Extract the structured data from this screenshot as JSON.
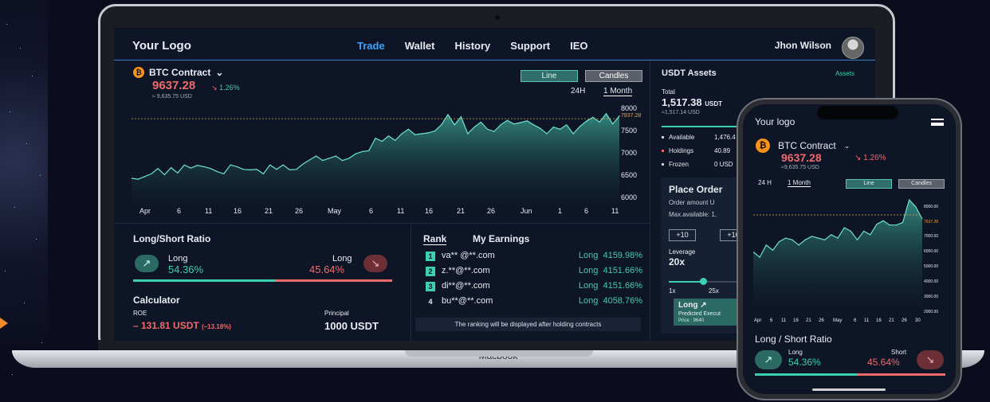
{
  "laptop_brand": "Macbook",
  "desktop": {
    "logo": "Your Logo",
    "nav": [
      "Trade",
      "Wallet",
      "History",
      "Support",
      "IEO"
    ],
    "user": "Jhon Wilson",
    "contract": "BTC Contract",
    "contract_icon": "bitcoin-icon",
    "price": "9637.28",
    "change": "1.26%",
    "subprice": "≈ 9,635.75 USD",
    "chart_mode_buttons": [
      "Line",
      "Candles"
    ],
    "ranges": [
      "24H",
      "1 Month"
    ],
    "y_ticks": [
      "8000",
      "7837.28",
      "7500",
      "7000",
      "6500",
      "6000"
    ],
    "x_ticks": [
      "Apr",
      "6",
      "11",
      "16",
      "21",
      "26",
      "May",
      "6",
      "11",
      "16",
      "21",
      "26",
      "Jun",
      "1",
      "6",
      "11"
    ],
    "long_short": {
      "title": "Long/Short Ratio",
      "long_label": "Long",
      "long_value": "54.36%",
      "short_label": "Long",
      "short_value": "45.64%"
    },
    "calculator": {
      "title": "Calculator",
      "roe_label": "ROE",
      "roe_value": "– 131.81 USDT",
      "roe_pct": "(–13.18%)",
      "principal_label": "Principal",
      "principal_value": "1000 USDT"
    },
    "rank": {
      "tab_rank": "Rank",
      "tab_earnings": "My Earnings",
      "rows": [
        {
          "num": "1",
          "email": "va** @**.com",
          "side": "Long",
          "value": "4159.98%"
        },
        {
          "num": "2",
          "email": "z.**@**.com",
          "side": "Long",
          "value": "4151.66%"
        },
        {
          "num": "3",
          "email": "di**@**.com",
          "side": "Long",
          "value": "4151.66%"
        },
        {
          "num": "4",
          "email": "bu**@**.com",
          "side": "Long",
          "value": "4058.76%"
        }
      ],
      "note": "The ranking will be displayed after holding contracts"
    },
    "assets": {
      "title": "USDT Assets",
      "link": "Assets",
      "total_label": "Total",
      "total_value": "1,517.38",
      "total_unit": "USDT",
      "total_sub": "≈1,517.14 USD",
      "rows": [
        {
          "label": "Available",
          "amount": "1,476.4"
        },
        {
          "label": "Holdings",
          "amount": "40.89"
        },
        {
          "label": "Frozen",
          "amount": "0 USD"
        }
      ]
    },
    "place_order": {
      "title": "Place Order",
      "order_amount": "Order amount U",
      "max_available": "Max.available: 1,",
      "quick_buttons": [
        "+10",
        "+10"
      ],
      "leverage_label": "Leverage",
      "leverage_value": "20x",
      "slider_min": "1x",
      "slider_mid": "25x",
      "long_card_title": "Long",
      "long_card_sub": "Predicted Execut",
      "long_card_price": "Price : 9640"
    }
  },
  "phone": {
    "logo": "Your logo",
    "contract": "BTC Contract",
    "price": "9637.28",
    "change": "1.26%",
    "subprice": "≈9,635.75 USD",
    "ranges": [
      "24 H",
      "1 Month"
    ],
    "chart_mode_buttons": [
      "Line",
      "Candles"
    ],
    "y_ticks": [
      "8000.00",
      "7637.28",
      "7000.00",
      "6000.00",
      "5000.00",
      "4000.00",
      "3000.00",
      "2000.00"
    ],
    "x_ticks": [
      "Apr",
      "6",
      "11",
      "16",
      "21",
      "26",
      "May",
      "6",
      "11",
      "16",
      "21",
      "26",
      "30"
    ],
    "long_short": {
      "title": "Long / Short Ratio",
      "long_label": "Long",
      "long_value": "54.36%",
      "short_label": "Short",
      "short_value": "45.64%"
    }
  },
  "chart_data": [
    {
      "type": "area",
      "title": "BTC Contract",
      "xlabel": "",
      "ylabel": "",
      "ylim": [
        6000,
        8000
      ],
      "x_tick_labels": [
        "Apr",
        "6",
        "11",
        "16",
        "21",
        "26",
        "May",
        "6",
        "11",
        "16",
        "21",
        "26",
        "Jun",
        "1",
        "6",
        "11"
      ],
      "reference_line": 7837.28,
      "values": [
        6500,
        6480,
        6540,
        6600,
        6720,
        6580,
        6740,
        6620,
        6800,
        6730,
        6790,
        6760,
        6720,
        6650,
        6600,
        6800,
        6760,
        6700,
        6690,
        6700,
        6600,
        6800,
        6700,
        6800,
        6690,
        6700,
        6820,
        6910,
        7000,
        6900,
        6950,
        7000,
        6900,
        6950,
        7050,
        7100,
        7120,
        7400,
        7330,
        7450,
        7350,
        7500,
        7600,
        7480,
        7500,
        7520,
        7560,
        7700,
        7930,
        7700,
        7880,
        7500,
        7650,
        7760,
        7600,
        7550,
        7700,
        7800,
        7720,
        7750,
        7790,
        7700,
        7620,
        7500,
        7650,
        7600,
        7700,
        7500,
        7660,
        7780,
        7870,
        7760,
        7950,
        7720,
        7900
      ]
    },
    {
      "type": "area",
      "title": "BTC Contract",
      "ylim": [
        2000,
        8000
      ],
      "x_tick_labels": [
        "Apr",
        "6",
        "11",
        "16",
        "21",
        "26",
        "May",
        "6",
        "11",
        "16",
        "21",
        "26",
        "30"
      ],
      "reference_line": 7637.28,
      "values": [
        5500,
        5200,
        5900,
        5600,
        6100,
        6300,
        6200,
        5900,
        6200,
        6400,
        6300,
        6200,
        6500,
        6300,
        6900,
        6700,
        6200,
        6700,
        6500,
        7100,
        7300,
        7050,
        7050,
        7200,
        8500,
        8100,
        7400
      ]
    }
  ]
}
